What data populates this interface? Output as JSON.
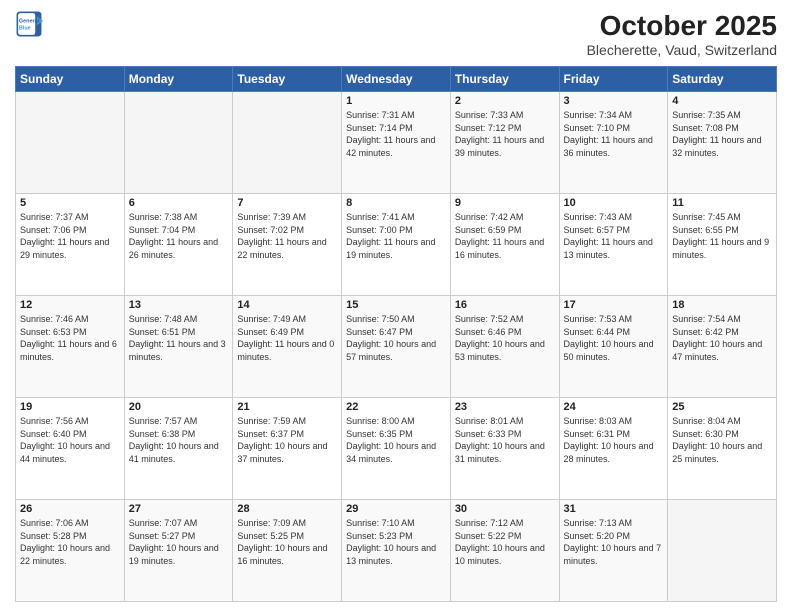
{
  "header": {
    "logo_line1": "General",
    "logo_line2": "Blue",
    "title": "October 2025",
    "subtitle": "Blecherette, Vaud, Switzerland"
  },
  "days_of_week": [
    "Sunday",
    "Monday",
    "Tuesday",
    "Wednesday",
    "Thursday",
    "Friday",
    "Saturday"
  ],
  "weeks": [
    [
      {
        "day": "",
        "sunrise": "",
        "sunset": "",
        "daylight": ""
      },
      {
        "day": "",
        "sunrise": "",
        "sunset": "",
        "daylight": ""
      },
      {
        "day": "",
        "sunrise": "",
        "sunset": "",
        "daylight": ""
      },
      {
        "day": "1",
        "sunrise": "Sunrise: 7:31 AM",
        "sunset": "Sunset: 7:14 PM",
        "daylight": "Daylight: 11 hours and 42 minutes."
      },
      {
        "day": "2",
        "sunrise": "Sunrise: 7:33 AM",
        "sunset": "Sunset: 7:12 PM",
        "daylight": "Daylight: 11 hours and 39 minutes."
      },
      {
        "day": "3",
        "sunrise": "Sunrise: 7:34 AM",
        "sunset": "Sunset: 7:10 PM",
        "daylight": "Daylight: 11 hours and 36 minutes."
      },
      {
        "day": "4",
        "sunrise": "Sunrise: 7:35 AM",
        "sunset": "Sunset: 7:08 PM",
        "daylight": "Daylight: 11 hours and 32 minutes."
      }
    ],
    [
      {
        "day": "5",
        "sunrise": "Sunrise: 7:37 AM",
        "sunset": "Sunset: 7:06 PM",
        "daylight": "Daylight: 11 hours and 29 minutes."
      },
      {
        "day": "6",
        "sunrise": "Sunrise: 7:38 AM",
        "sunset": "Sunset: 7:04 PM",
        "daylight": "Daylight: 11 hours and 26 minutes."
      },
      {
        "day": "7",
        "sunrise": "Sunrise: 7:39 AM",
        "sunset": "Sunset: 7:02 PM",
        "daylight": "Daylight: 11 hours and 22 minutes."
      },
      {
        "day": "8",
        "sunrise": "Sunrise: 7:41 AM",
        "sunset": "Sunset: 7:00 PM",
        "daylight": "Daylight: 11 hours and 19 minutes."
      },
      {
        "day": "9",
        "sunrise": "Sunrise: 7:42 AM",
        "sunset": "Sunset: 6:59 PM",
        "daylight": "Daylight: 11 hours and 16 minutes."
      },
      {
        "day": "10",
        "sunrise": "Sunrise: 7:43 AM",
        "sunset": "Sunset: 6:57 PM",
        "daylight": "Daylight: 11 hours and 13 minutes."
      },
      {
        "day": "11",
        "sunrise": "Sunrise: 7:45 AM",
        "sunset": "Sunset: 6:55 PM",
        "daylight": "Daylight: 11 hours and 9 minutes."
      }
    ],
    [
      {
        "day": "12",
        "sunrise": "Sunrise: 7:46 AM",
        "sunset": "Sunset: 6:53 PM",
        "daylight": "Daylight: 11 hours and 6 minutes."
      },
      {
        "day": "13",
        "sunrise": "Sunrise: 7:48 AM",
        "sunset": "Sunset: 6:51 PM",
        "daylight": "Daylight: 11 hours and 3 minutes."
      },
      {
        "day": "14",
        "sunrise": "Sunrise: 7:49 AM",
        "sunset": "Sunset: 6:49 PM",
        "daylight": "Daylight: 11 hours and 0 minutes."
      },
      {
        "day": "15",
        "sunrise": "Sunrise: 7:50 AM",
        "sunset": "Sunset: 6:47 PM",
        "daylight": "Daylight: 10 hours and 57 minutes."
      },
      {
        "day": "16",
        "sunrise": "Sunrise: 7:52 AM",
        "sunset": "Sunset: 6:46 PM",
        "daylight": "Daylight: 10 hours and 53 minutes."
      },
      {
        "day": "17",
        "sunrise": "Sunrise: 7:53 AM",
        "sunset": "Sunset: 6:44 PM",
        "daylight": "Daylight: 10 hours and 50 minutes."
      },
      {
        "day": "18",
        "sunrise": "Sunrise: 7:54 AM",
        "sunset": "Sunset: 6:42 PM",
        "daylight": "Daylight: 10 hours and 47 minutes."
      }
    ],
    [
      {
        "day": "19",
        "sunrise": "Sunrise: 7:56 AM",
        "sunset": "Sunset: 6:40 PM",
        "daylight": "Daylight: 10 hours and 44 minutes."
      },
      {
        "day": "20",
        "sunrise": "Sunrise: 7:57 AM",
        "sunset": "Sunset: 6:38 PM",
        "daylight": "Daylight: 10 hours and 41 minutes."
      },
      {
        "day": "21",
        "sunrise": "Sunrise: 7:59 AM",
        "sunset": "Sunset: 6:37 PM",
        "daylight": "Daylight: 10 hours and 37 minutes."
      },
      {
        "day": "22",
        "sunrise": "Sunrise: 8:00 AM",
        "sunset": "Sunset: 6:35 PM",
        "daylight": "Daylight: 10 hours and 34 minutes."
      },
      {
        "day": "23",
        "sunrise": "Sunrise: 8:01 AM",
        "sunset": "Sunset: 6:33 PM",
        "daylight": "Daylight: 10 hours and 31 minutes."
      },
      {
        "day": "24",
        "sunrise": "Sunrise: 8:03 AM",
        "sunset": "Sunset: 6:31 PM",
        "daylight": "Daylight: 10 hours and 28 minutes."
      },
      {
        "day": "25",
        "sunrise": "Sunrise: 8:04 AM",
        "sunset": "Sunset: 6:30 PM",
        "daylight": "Daylight: 10 hours and 25 minutes."
      }
    ],
    [
      {
        "day": "26",
        "sunrise": "Sunrise: 7:06 AM",
        "sunset": "Sunset: 5:28 PM",
        "daylight": "Daylight: 10 hours and 22 minutes."
      },
      {
        "day": "27",
        "sunrise": "Sunrise: 7:07 AM",
        "sunset": "Sunset: 5:27 PM",
        "daylight": "Daylight: 10 hours and 19 minutes."
      },
      {
        "day": "28",
        "sunrise": "Sunrise: 7:09 AM",
        "sunset": "Sunset: 5:25 PM",
        "daylight": "Daylight: 10 hours and 16 minutes."
      },
      {
        "day": "29",
        "sunrise": "Sunrise: 7:10 AM",
        "sunset": "Sunset: 5:23 PM",
        "daylight": "Daylight: 10 hours and 13 minutes."
      },
      {
        "day": "30",
        "sunrise": "Sunrise: 7:12 AM",
        "sunset": "Sunset: 5:22 PM",
        "daylight": "Daylight: 10 hours and 10 minutes."
      },
      {
        "day": "31",
        "sunrise": "Sunrise: 7:13 AM",
        "sunset": "Sunset: 5:20 PM",
        "daylight": "Daylight: 10 hours and 7 minutes."
      },
      {
        "day": "",
        "sunrise": "",
        "sunset": "",
        "daylight": ""
      }
    ]
  ]
}
